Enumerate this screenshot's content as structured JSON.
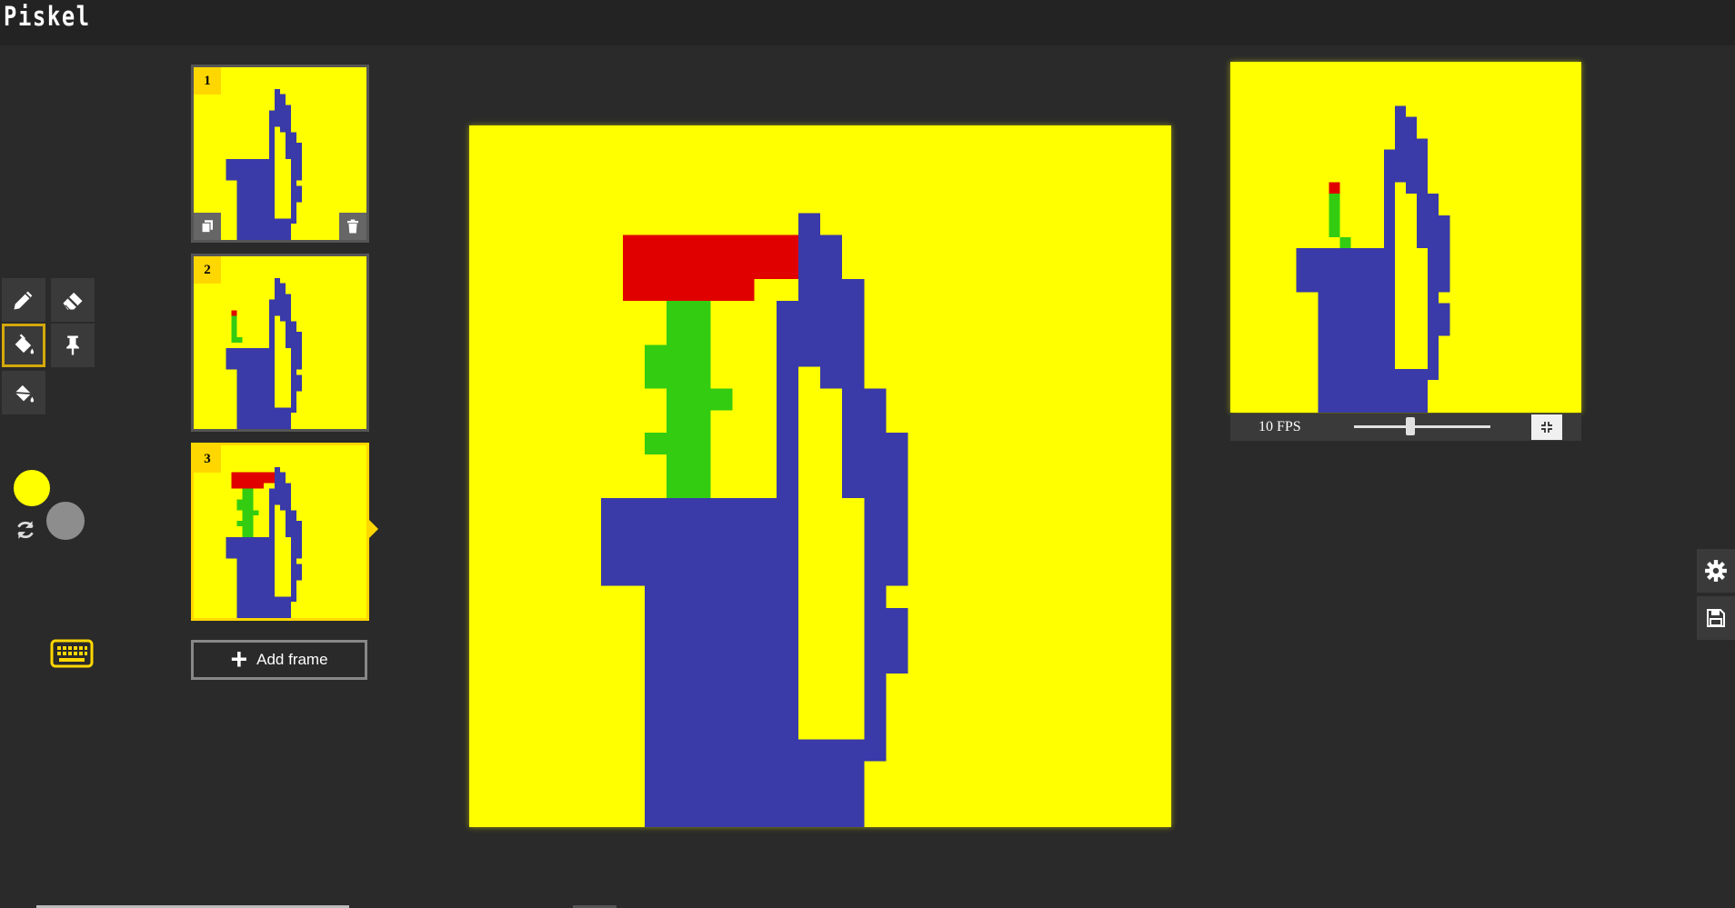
{
  "app": {
    "title": "Piskel"
  },
  "tools": [
    {
      "name": "pen-tool",
      "icon": "pencil-icon",
      "selected": false
    },
    {
      "name": "eraser-tool",
      "icon": "eraser-icon",
      "selected": false
    },
    {
      "name": "paint-bucket-tool",
      "icon": "paint-bucket-icon",
      "selected": true
    },
    {
      "name": "pin-tool",
      "icon": "pin-icon",
      "selected": false
    },
    {
      "name": "color-replace-tool",
      "icon": "bucket-replace-icon",
      "selected": false
    }
  ],
  "palette": {
    "primary_color": "#ffff00",
    "secondary_color": "#8d8d8d"
  },
  "frames": [
    {
      "number": "1",
      "active": false
    },
    {
      "number": "2",
      "active": false
    },
    {
      "number": "3",
      "active": true
    }
  ],
  "add_frame_label": "Add frame",
  "preview": {
    "fps_label": "10 FPS",
    "fps_value": 10
  },
  "colors": {
    "background": "#ffff00",
    "vase": "#3a3aa8",
    "stem": "#33cc11",
    "flower": "#e00000",
    "accent": "#ffd700"
  }
}
